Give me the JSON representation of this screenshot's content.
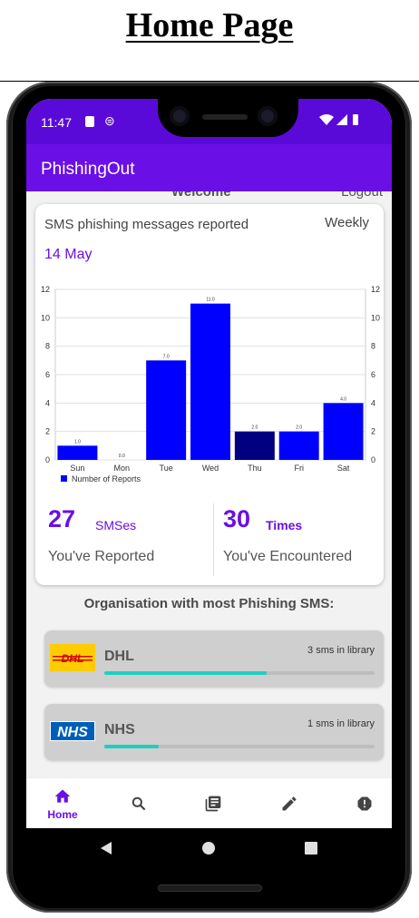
{
  "document": {
    "title": "Home Page"
  },
  "status_bar": {
    "time": "11:47",
    "icon_left": "sd-card-icon",
    "icon_middle": "data-saver-icon",
    "icons_right": [
      "wifi-icon",
      "signal-icon",
      "battery-icon"
    ]
  },
  "app_bar": {
    "title": "PhishingOut",
    "color": "#6a0fe6"
  },
  "ghost": {
    "welcome": "Welcome",
    "logout": "Logout"
  },
  "summary_card": {
    "title": "SMS phishing messages reported",
    "range_selector": "Weekly",
    "date": "14 May",
    "reported": {
      "value": "27",
      "unit": "SMSes",
      "label": "You've Reported"
    },
    "encountered": {
      "value": "30",
      "unit": "Times",
      "label": "You've Encountered"
    }
  },
  "chart_data": {
    "type": "bar",
    "categories": [
      "Sun",
      "Mon",
      "Tue",
      "Wed",
      "Thu",
      "Fri",
      "Sat"
    ],
    "series": [
      {
        "name": "Number of Reports",
        "values": [
          1,
          0,
          7,
          11,
          2,
          2,
          4
        ],
        "color": "#0000ff",
        "highlight_index": 4,
        "highlight_color": "#000080"
      }
    ],
    "value_labels": [
      "1.0",
      "0.0",
      "7.0",
      "11.0",
      "2.0",
      "2.0",
      "4.0"
    ],
    "ylim": [
      0,
      12
    ],
    "y_ticks": [
      0,
      2,
      4,
      6,
      8,
      10,
      12
    ],
    "grid": true,
    "legend": "bottom-left",
    "dual_y_axis": true
  },
  "organisations": {
    "heading": "Organisation with most Phishing SMS:",
    "items": [
      {
        "name": "DHL",
        "count_label": "3 sms in library",
        "progress": 0.6,
        "logo_text": "DHL",
        "logo_color": "#ffcc00",
        "logo_text_color": "#d40511"
      },
      {
        "name": "NHS",
        "count_label": "1 sms in library",
        "progress": 0.2,
        "logo_text": "NHS",
        "logo_color": "#005eb8",
        "logo_text_color": "#ffffff"
      }
    ]
  },
  "bottom_nav": {
    "items": [
      {
        "icon": "home-icon",
        "label": "Home",
        "active": true
      },
      {
        "icon": "search-icon",
        "label": "",
        "active": false
      },
      {
        "icon": "library-icon",
        "label": "",
        "active": false
      },
      {
        "icon": "edit-icon",
        "label": "",
        "active": false
      },
      {
        "icon": "report-icon",
        "label": "",
        "active": false
      }
    ]
  },
  "system_nav": [
    "back-icon",
    "home-circle-icon",
    "recents-icon"
  ]
}
